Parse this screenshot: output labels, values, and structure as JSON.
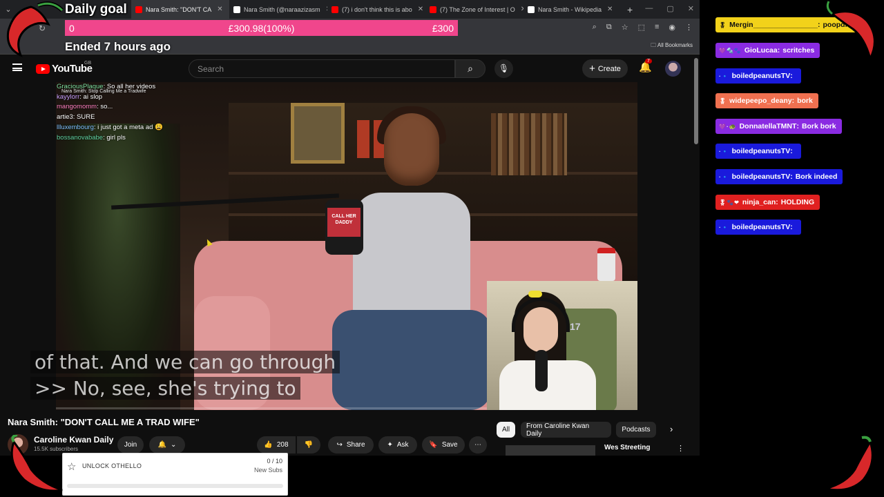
{
  "goal": {
    "title": "Daily goal",
    "start": "0",
    "current": "£300.98(100%)",
    "target": "£300",
    "progress_fraction": 1.0,
    "status": "Ended 7 hours ago"
  },
  "browser": {
    "tabs": [
      {
        "label": "Nara Smith: \"DON'T CA",
        "icon_color": "#ff0000",
        "active": true
      },
      {
        "label": "Nara Smith (@naraazizasm",
        "icon_color": "#ffffff",
        "active": false
      },
      {
        "label": "(7) i don't think this is abo",
        "icon_color": "#ff0000",
        "active": false
      },
      {
        "label": "(7) The Zone of Interest | O",
        "icon_color": "#ff0000",
        "active": false
      },
      {
        "label": "Nara Smith - Wikipedia",
        "icon_color": "#ffffff",
        "active": false
      }
    ],
    "new_tab": "+",
    "bookmarks_label": "All Bookmarks"
  },
  "youtube": {
    "logo_text": "YouTube",
    "region": "GB",
    "search_placeholder": "Search",
    "create_label": "Create",
    "notification_count": "7",
    "video_title": "Nara Smith: \"DON'T CALL ME A TRAD WIFE\"",
    "channel_name": "Caroline Kwan Daily",
    "channel_subs": "15.5K subscribers",
    "join_label": "Join",
    "likes": "208",
    "share_label": "Share",
    "ask_label": "Ask",
    "save_label": "Save",
    "chips": [
      "All",
      "From Caroline Kwan Daily",
      "Podcasts"
    ],
    "rec_title": "Wes Streeting",
    "video_mic_flag": "CALL HER DADDY"
  },
  "captions": [
    "of that. And we can go through",
    ">> No, see, she's trying to"
  ],
  "overlay_chat": {
    "header": "Nara Smith: Stop Calling Me a Tradwife",
    "lines": [
      {
        "user": "GraciousPlaque",
        "color": "#7ee0a0",
        "text": "So all her videos"
      },
      {
        "user": "kayylorr",
        "color": "#c8a0ff",
        "text": "ai slop"
      },
      {
        "user": "mangomomm",
        "color": "#ff80c0",
        "text": "so..."
      },
      {
        "user": "artie3",
        "color": "#ffffff",
        "text": "SURE"
      },
      {
        "user": "llluxembourg",
        "color": "#80c0ff",
        "text": "i just got a meta ad 😩"
      },
      {
        "user": "bossanovababe",
        "color": "#60d0a0",
        "text": "girl pls"
      }
    ]
  },
  "side_chat": [
    {
      "user": "Mergin________________",
      "text": "poopdle",
      "bg": "#f2d21a",
      "fg": "#111111",
      "badges": "🎖"
    },
    {
      "user": "GioLucaa",
      "text": "scritches",
      "bg": "#8a2be2",
      "fg": "#ffffff",
      "badges": "💜🔩🐾"
    },
    {
      "user": "boiledpeanutsTV",
      "text": "",
      "bg": "#1a1adc",
      "fg": "#ffffff",
      "badges": "·🔹"
    },
    {
      "user": "widepeepo_deany",
      "text": "bork",
      "bg": "#f07050",
      "fg": "#ffffff",
      "badges": "🎖"
    },
    {
      "user": "DonnatellaTMNT",
      "text": "Bork bork",
      "bg": "#8a2be2",
      "fg": "#ffffff",
      "badges": "💜·🐢"
    },
    {
      "user": "boiledpeanutsTV",
      "text": "",
      "bg": "#1a1adc",
      "fg": "#ffffff",
      "badges": "·🔹"
    },
    {
      "user": "boiledpeanutsTV",
      "text": "Bork indeed",
      "bg": "#1a1adc",
      "fg": "#ffffff",
      "badges": "·🔹"
    },
    {
      "user": "ninja_can",
      "text": "HOLDING",
      "bg": "#e02020",
      "fg": "#ffffff",
      "badges": "🎖🐾❤"
    },
    {
      "user": "boiledpeanutsTV",
      "text": "",
      "bg": "#1a1adc",
      "fg": "#ffffff",
      "badges": "·🔹"
    }
  ],
  "unlock_widget": {
    "label": "UNLOCK OTHELLO",
    "count": "0 / 10",
    "unit": "New Subs",
    "progress_fraction": 0
  },
  "colors": {
    "goal_bar": "#f0468c",
    "youtube_red": "#ff0000",
    "chili": "#d8282a"
  }
}
